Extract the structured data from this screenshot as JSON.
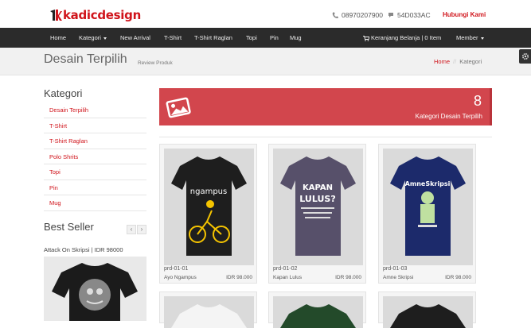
{
  "brand": {
    "name": "kadicdesign"
  },
  "contact": {
    "phone": "08970207900",
    "bbm": "54D033AC",
    "cta": "Hubungi Kami"
  },
  "nav": {
    "items": [
      "Home",
      "Kategori",
      "New Arrival",
      "T-Shirt",
      "T-Shirt Raglan",
      "Topi",
      "Pin",
      "Mug"
    ],
    "cart": "Keranjang Belanja | 0 Item",
    "member": "Member"
  },
  "page": {
    "title": "Desain Terpilih",
    "subtitle": "Review Produk",
    "breadcrumb": [
      "Home",
      "Kategori"
    ]
  },
  "sidebar": {
    "heading": "Kategori",
    "items": [
      "Desain Terpilih",
      "T-Shirt",
      "T-Shirt Raglan",
      "Polo Shrits",
      "Topi",
      "Pin",
      "Mug"
    ],
    "best_seller": "Best Seller",
    "best_seller_caption": "Attack On Skripsi | IDR 98000"
  },
  "banner": {
    "count": "8",
    "label": "Kategori Desain Terpilih"
  },
  "products": [
    {
      "code": "prd-01-01",
      "name": "Ayo Ngampus",
      "price": "IDR 98.000",
      "shirt": "#1e1e1e",
      "print": "ngampus"
    },
    {
      "code": "prd-01-02",
      "name": "Kapan Lulus",
      "price": "IDR 98.000",
      "shirt": "#57506a",
      "print": "KAPAN LULUS?"
    },
    {
      "code": "prd-01-03",
      "name": "Amne Skripsi",
      "price": "IDR 98.000",
      "shirt": "#1c2a6b",
      "print": "AmneSkripsi"
    }
  ],
  "colors": {
    "accent": "#d0141b",
    "banner": "#d2464d",
    "nav": "#2b2b2b"
  }
}
